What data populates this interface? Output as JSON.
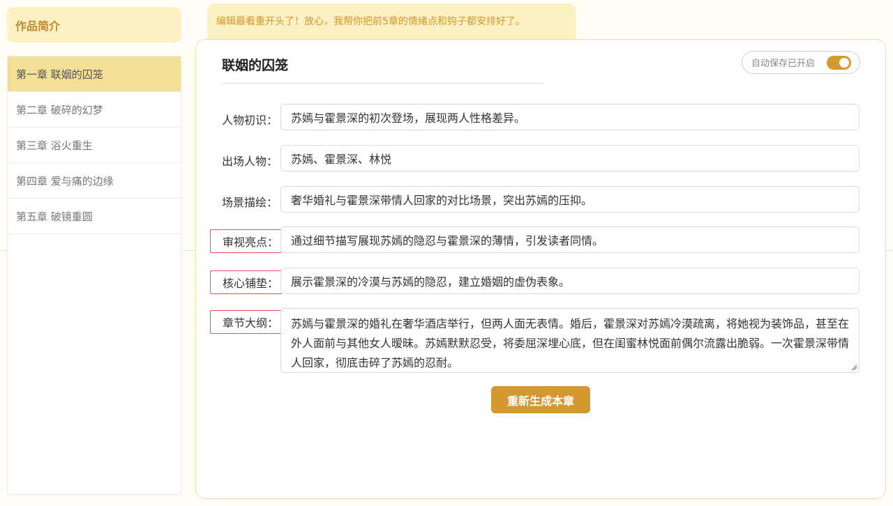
{
  "sidebar": {
    "intro_label": "作品简介",
    "chapters": [
      {
        "label": "第一章 联姻的囚笼",
        "active": true
      },
      {
        "label": "第二章 破碎的幻梦",
        "active": false
      },
      {
        "label": "第三章 浴火重生",
        "active": false
      },
      {
        "label": "第四章 爱与痛的边缘",
        "active": false
      },
      {
        "label": "第五章 破镜重圆",
        "active": false
      }
    ]
  },
  "banner": {
    "message": "编辑最看重开头了！放心，我帮你把前5章的情绪点和钩子都安排好了。"
  },
  "editor": {
    "title": "联姻的囚笼",
    "autosave_label": "自动保存已开启",
    "autosave_on": true,
    "fields": {
      "characters_intro": {
        "label": "人物初识：",
        "value": "苏嫣与霍景深的初次登场，展现两人性格差异。"
      },
      "cast": {
        "label": "出场人物：",
        "value": "苏嫣、霍景深、林悦"
      },
      "scene": {
        "label": "场景描绘：",
        "value": "奢华婚礼与霍景深带情人回家的对比场景，突出苏嫣的压抑。"
      },
      "highlight": {
        "label": "审视亮点：",
        "value": "通过细节描写展现苏嫣的隐忍与霍景深的薄情，引发读者同情。"
      },
      "setup": {
        "label": "核心铺垫：",
        "value": "展示霍景深的冷漠与苏嫣的隐忍，建立婚姻的虚伪表象。"
      },
      "outline": {
        "label": "章节大纲：",
        "value": "苏嫣与霍景深的婚礼在奢华酒店举行，但两人面无表情。婚后，霍景深对苏嫣冷漠疏离，将她视为装饰品，甚至在外人面前与其他女人暧昧。苏嫣默默忍受，将委屈深埋心底，但在闺蜜林悦面前偶尔流露出脆弱。一次霍景深带情人回家，彻底击碎了苏嫣的忍耐。"
      }
    },
    "regenerate_label": "重新生成本章"
  },
  "colors": {
    "accent": "#d4982e",
    "active_chapter_bg": "#f3df95",
    "banner_bg": "#fdf0c2",
    "highlight_border": "#e0585a"
  }
}
